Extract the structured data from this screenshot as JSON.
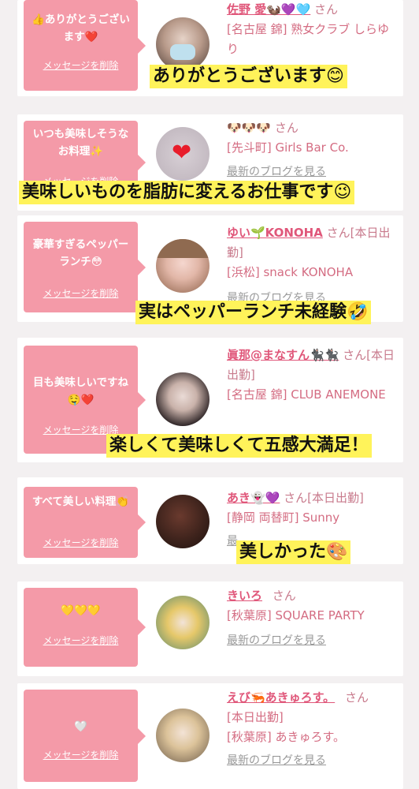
{
  "cards": [
    {
      "message": "👍ありがとうございます❤️",
      "delete_label": "メッセージを削除",
      "name": "佐野 愛🦦💜🩵",
      "san": "さん",
      "shop": "[名古屋 錦] 熟女クラブ しらゆり",
      "overlay": "ありがとうございます😊"
    },
    {
      "message": "いつも美味しそうなお料理✨",
      "delete_label": "メッセージを削除",
      "name": "🐶🐶🐶",
      "san": "さん",
      "shop": "[先斗町] Girls Bar Co.",
      "blog": "最新のブログを見る",
      "overlay": "美味しいものを脂肪に変えるお仕事です😉"
    },
    {
      "message": "豪華すぎるペッパーランチ😳",
      "delete_label": "メッセージを削除",
      "name": "ゆい🌱KONOHA",
      "san": "さん[本日出勤]",
      "shop": "[浜松] snack KONOHA",
      "blog": "最新のブログを見る",
      "overlay": "実はペッパーランチ未経験🤣"
    },
    {
      "message": "目も美味しいですね🤤❤️",
      "delete_label": "メッセージを削除",
      "name": "眞那@まなすん🐈‍⬛🐈‍⬛",
      "san": "さん[本日出勤]",
      "shop": "[名古屋 錦] CLUB ANEMONE",
      "overlay": "楽しくて美味しくて五感大満足！"
    },
    {
      "message": "すべて美しい料理👏",
      "delete_label": "メッセージを削除",
      "name": "あき👻💜",
      "san": "さん[本日出勤]",
      "shop": "[静岡 両替町] Sunny",
      "blog": "最",
      "overlay": "美しかった🎨"
    },
    {
      "message": "💛💛💛",
      "delete_label": "メッセージを削除",
      "name": "きいろ",
      "san": "さん",
      "shop": "[秋葉原] SQUARE PARTY",
      "blog": "最新のブログを見る"
    },
    {
      "message": "🤍",
      "delete_label": "メッセージを削除",
      "name": "えび🦐あきゅろす。",
      "san": "さん",
      "status": "[本日出勤]",
      "shop": "[秋葉原] あきゅろす。",
      "blog": "最新のブログを見る"
    }
  ]
}
